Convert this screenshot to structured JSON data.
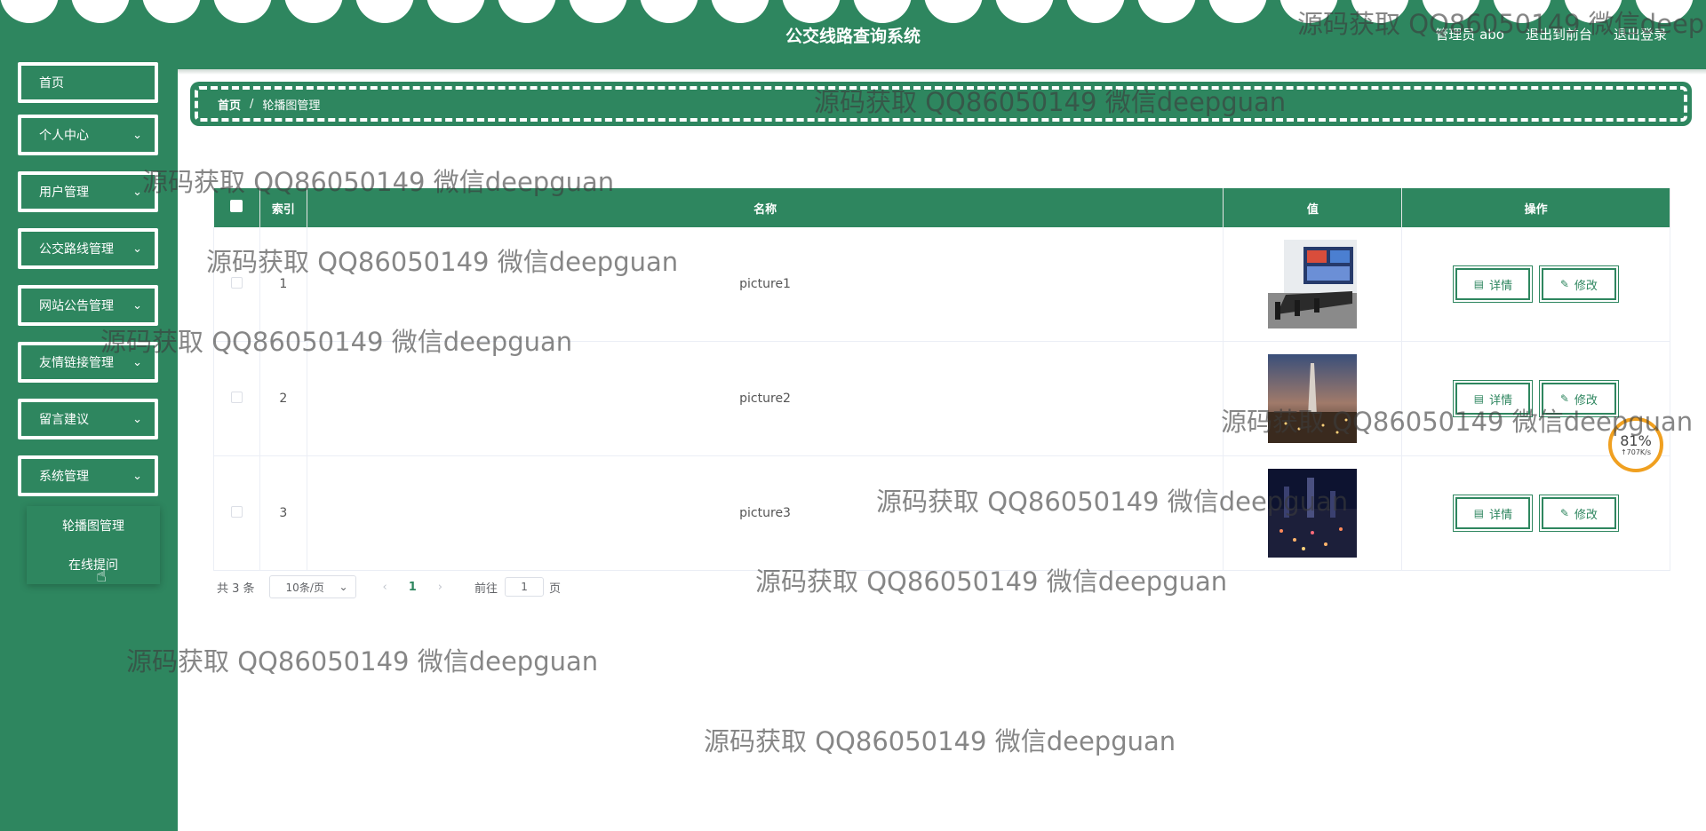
{
  "header": {
    "title": "公交线路查询系统",
    "admin": "管理员 abo",
    "front": "退出到前台",
    "logout": "退出登录"
  },
  "sidebar": {
    "items": [
      {
        "label": "首页"
      },
      {
        "label": "个人中心"
      },
      {
        "label": "用户管理"
      },
      {
        "label": "公交路线管理"
      },
      {
        "label": "网站公告管理"
      },
      {
        "label": "友情链接管理"
      },
      {
        "label": "留言建议"
      },
      {
        "label": "系统管理"
      }
    ],
    "submenu": [
      {
        "label": "轮播图管理"
      },
      {
        "label": "在线提问"
      }
    ]
  },
  "breadcrumb": {
    "home": "首页",
    "separator": "/",
    "current": "轮播图管理"
  },
  "table": {
    "columns": [
      "索引",
      "名称",
      "值",
      "操作"
    ],
    "rows": [
      {
        "index": "1",
        "name": "picture1"
      },
      {
        "index": "2",
        "name": "picture2"
      },
      {
        "index": "3",
        "name": "picture3"
      }
    ],
    "detail_label": "详情",
    "edit_label": "修改"
  },
  "pagination": {
    "total": "共 3 条",
    "size": "10条/页",
    "current_page": "1",
    "goto_label": "前往",
    "goto_value": "1",
    "goto_suffix": "页"
  },
  "watermark": "源码获取 QQ86050149 微信deepguan",
  "speed_widget": {
    "percent": "81%",
    "rate": "↑707K/s"
  },
  "colors": {
    "primary": "#2e865f",
    "accent": "#f0a020"
  }
}
